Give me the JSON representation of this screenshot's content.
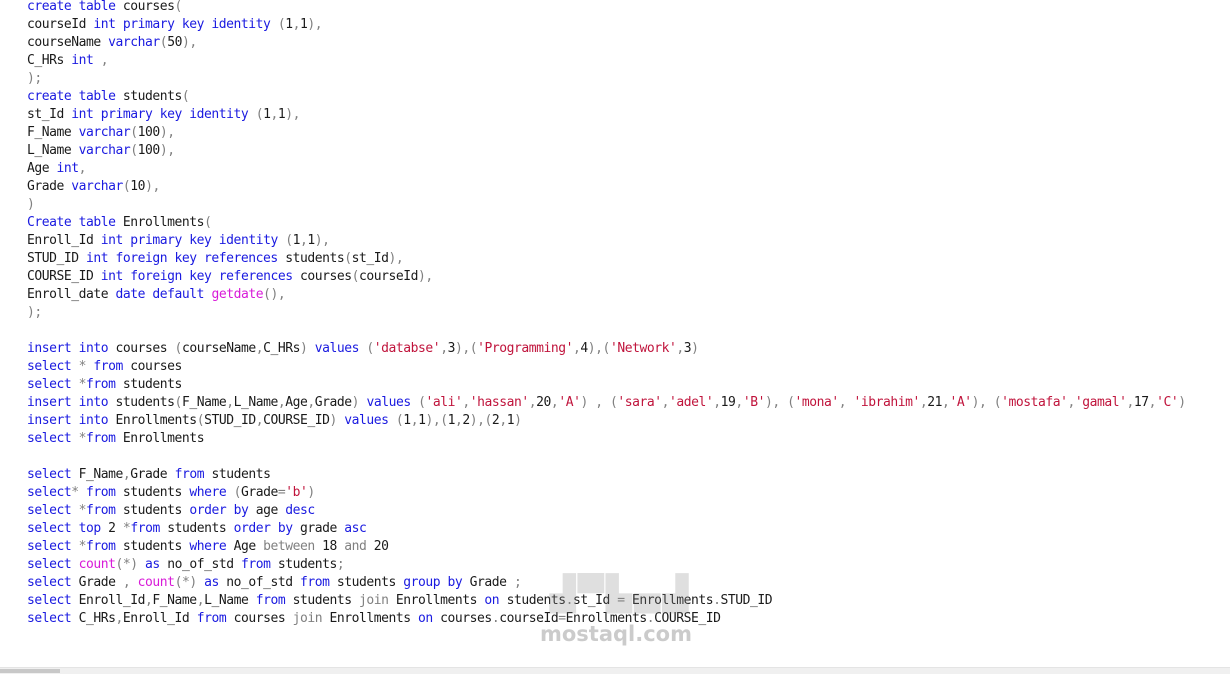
{
  "editor": {
    "lines": [
      [
        [
          "create table ",
          "kw"
        ],
        [
          "courses",
          "pl"
        ],
        [
          "(",
          "gr"
        ]
      ],
      [
        [
          "courseId ",
          "pl"
        ],
        [
          "int primary key identity ",
          "kw"
        ],
        [
          "(",
          "gr"
        ],
        [
          "1",
          "pl"
        ],
        [
          ",",
          "gr"
        ],
        [
          "1",
          "pl"
        ],
        [
          "),",
          "gr"
        ]
      ],
      [
        [
          "courseName ",
          "pl"
        ],
        [
          "varchar",
          "kw"
        ],
        [
          "(",
          "gr"
        ],
        [
          "50",
          "pl"
        ],
        [
          "),",
          "gr"
        ]
      ],
      [
        [
          "C_HRs ",
          "pl"
        ],
        [
          "int ",
          "kw"
        ],
        [
          ",",
          "gr"
        ]
      ],
      [
        [
          ");",
          "gr"
        ]
      ],
      [
        [
          "create table ",
          "kw"
        ],
        [
          "students",
          "pl"
        ],
        [
          "(",
          "gr"
        ]
      ],
      [
        [
          "st_Id ",
          "pl"
        ],
        [
          "int primary key identity ",
          "kw"
        ],
        [
          "(",
          "gr"
        ],
        [
          "1",
          "pl"
        ],
        [
          ",",
          "gr"
        ],
        [
          "1",
          "pl"
        ],
        [
          "),",
          "gr"
        ]
      ],
      [
        [
          "F_Name ",
          "pl"
        ],
        [
          "varchar",
          "kw"
        ],
        [
          "(",
          "gr"
        ],
        [
          "100",
          "pl"
        ],
        [
          "),",
          "gr"
        ]
      ],
      [
        [
          "L_Name ",
          "pl"
        ],
        [
          "varchar",
          "kw"
        ],
        [
          "(",
          "gr"
        ],
        [
          "100",
          "pl"
        ],
        [
          "),",
          "gr"
        ]
      ],
      [
        [
          "Age ",
          "pl"
        ],
        [
          "int",
          "kw"
        ],
        [
          ",",
          "gr"
        ]
      ],
      [
        [
          "Grade ",
          "pl"
        ],
        [
          "varchar",
          "kw"
        ],
        [
          "(",
          "gr"
        ],
        [
          "10",
          "pl"
        ],
        [
          "),",
          "gr"
        ]
      ],
      [
        [
          ")",
          "gr"
        ]
      ],
      [
        [
          "Create table ",
          "kw"
        ],
        [
          "Enrollments",
          "pl"
        ],
        [
          "(",
          "gr"
        ]
      ],
      [
        [
          "Enroll_Id ",
          "pl"
        ],
        [
          "int primary key identity ",
          "kw"
        ],
        [
          "(",
          "gr"
        ],
        [
          "1",
          "pl"
        ],
        [
          ",",
          "gr"
        ],
        [
          "1",
          "pl"
        ],
        [
          "),",
          "gr"
        ]
      ],
      [
        [
          "STUD_ID ",
          "pl"
        ],
        [
          "int foreign key references ",
          "kw"
        ],
        [
          "students",
          "pl"
        ],
        [
          "(",
          "gr"
        ],
        [
          "st_Id",
          "pl"
        ],
        [
          "),",
          "gr"
        ]
      ],
      [
        [
          "COURSE_ID ",
          "pl"
        ],
        [
          "int foreign key references ",
          "kw"
        ],
        [
          "courses",
          "pl"
        ],
        [
          "(",
          "gr"
        ],
        [
          "courseId",
          "pl"
        ],
        [
          "),",
          "gr"
        ]
      ],
      [
        [
          "Enroll_date ",
          "pl"
        ],
        [
          "date default ",
          "kw"
        ],
        [
          "getdate",
          "fn"
        ],
        [
          "(),",
          "gr"
        ]
      ],
      [
        [
          ");",
          "gr"
        ]
      ],
      [
        [
          "",
          "pl"
        ]
      ],
      [
        [
          "insert into ",
          "kw"
        ],
        [
          "courses ",
          "pl"
        ],
        [
          "(",
          "gr"
        ],
        [
          "courseName",
          "pl"
        ],
        [
          ",",
          "gr"
        ],
        [
          "C_HRs",
          "pl"
        ],
        [
          ") ",
          "gr"
        ],
        [
          "values ",
          "kw"
        ],
        [
          "(",
          "gr"
        ],
        [
          "'databse'",
          "str"
        ],
        [
          ",",
          "gr"
        ],
        [
          "3",
          "pl"
        ],
        [
          "),(",
          "gr"
        ],
        [
          "'Programming'",
          "str"
        ],
        [
          ",",
          "gr"
        ],
        [
          "4",
          "pl"
        ],
        [
          "),(",
          "gr"
        ],
        [
          "'Network'",
          "str"
        ],
        [
          ",",
          "gr"
        ],
        [
          "3",
          "pl"
        ],
        [
          ")",
          "gr"
        ]
      ],
      [
        [
          "select ",
          "kw"
        ],
        [
          "* ",
          "gr"
        ],
        [
          "from ",
          "kw"
        ],
        [
          "courses",
          "pl"
        ]
      ],
      [
        [
          "select ",
          "kw"
        ],
        [
          "*",
          "gr"
        ],
        [
          "from ",
          "kw"
        ],
        [
          "students",
          "pl"
        ]
      ],
      [
        [
          "insert into ",
          "kw"
        ],
        [
          "students",
          "pl"
        ],
        [
          "(",
          "gr"
        ],
        [
          "F_Name",
          "pl"
        ],
        [
          ",",
          "gr"
        ],
        [
          "L_Name",
          "pl"
        ],
        [
          ",",
          "gr"
        ],
        [
          "Age",
          "pl"
        ],
        [
          ",",
          "gr"
        ],
        [
          "Grade",
          "pl"
        ],
        [
          ") ",
          "gr"
        ],
        [
          "values ",
          "kw"
        ],
        [
          "(",
          "gr"
        ],
        [
          "'ali'",
          "str"
        ],
        [
          ",",
          "gr"
        ],
        [
          "'hassan'",
          "str"
        ],
        [
          ",",
          "gr"
        ],
        [
          "20",
          "pl"
        ],
        [
          ",",
          "gr"
        ],
        [
          "'A'",
          "str"
        ],
        [
          ") , (",
          "gr"
        ],
        [
          "'sara'",
          "str"
        ],
        [
          ",",
          "gr"
        ],
        [
          "'adel'",
          "str"
        ],
        [
          ",",
          "gr"
        ],
        [
          "19",
          "pl"
        ],
        [
          ",",
          "gr"
        ],
        [
          "'B'",
          "str"
        ],
        [
          "), (",
          "gr"
        ],
        [
          "'mona'",
          "str"
        ],
        [
          ", ",
          "gr"
        ],
        [
          "'ibrahim'",
          "str"
        ],
        [
          ",",
          "gr"
        ],
        [
          "21",
          "pl"
        ],
        [
          ",",
          "gr"
        ],
        [
          "'A'",
          "str"
        ],
        [
          "), (",
          "gr"
        ],
        [
          "'mostafa'",
          "str"
        ],
        [
          ",",
          "gr"
        ],
        [
          "'gamal'",
          "str"
        ],
        [
          ",",
          "gr"
        ],
        [
          "17",
          "pl"
        ],
        [
          ",",
          "gr"
        ],
        [
          "'C'",
          "str"
        ],
        [
          ")",
          "gr"
        ]
      ],
      [
        [
          "insert into ",
          "kw"
        ],
        [
          "Enrollments",
          "pl"
        ],
        [
          "(",
          "gr"
        ],
        [
          "STUD_ID",
          "pl"
        ],
        [
          ",",
          "gr"
        ],
        [
          "COURSE_ID",
          "pl"
        ],
        [
          ") ",
          "gr"
        ],
        [
          "values ",
          "kw"
        ],
        [
          "(",
          "gr"
        ],
        [
          "1",
          "pl"
        ],
        [
          ",",
          "gr"
        ],
        [
          "1",
          "pl"
        ],
        [
          "),(",
          "gr"
        ],
        [
          "1",
          "pl"
        ],
        [
          ",",
          "gr"
        ],
        [
          "2",
          "pl"
        ],
        [
          "),(",
          "gr"
        ],
        [
          "2",
          "pl"
        ],
        [
          ",",
          "gr"
        ],
        [
          "1",
          "pl"
        ],
        [
          ")",
          "gr"
        ]
      ],
      [
        [
          "select ",
          "kw"
        ],
        [
          "*",
          "gr"
        ],
        [
          "from ",
          "kw"
        ],
        [
          "Enrollments",
          "pl"
        ]
      ],
      [
        [
          "",
          "pl"
        ]
      ],
      [
        [
          "select ",
          "kw"
        ],
        [
          "F_Name",
          "pl"
        ],
        [
          ",",
          "gr"
        ],
        [
          "Grade ",
          "pl"
        ],
        [
          "from ",
          "kw"
        ],
        [
          "students",
          "pl"
        ]
      ],
      [
        [
          "select",
          "kw"
        ],
        [
          "* ",
          "gr"
        ],
        [
          "from ",
          "kw"
        ],
        [
          "students ",
          "pl"
        ],
        [
          "where ",
          "kw"
        ],
        [
          "(",
          "gr"
        ],
        [
          "Grade",
          "pl"
        ],
        [
          "=",
          "gr"
        ],
        [
          "'b'",
          "str"
        ],
        [
          ")",
          "gr"
        ]
      ],
      [
        [
          "select ",
          "kw"
        ],
        [
          "*",
          "gr"
        ],
        [
          "from ",
          "kw"
        ],
        [
          "students ",
          "pl"
        ],
        [
          "order by ",
          "kw"
        ],
        [
          "age ",
          "pl"
        ],
        [
          "desc",
          "kw"
        ]
      ],
      [
        [
          "select top ",
          "kw"
        ],
        [
          "2 ",
          "pl"
        ],
        [
          "*",
          "gr"
        ],
        [
          "from ",
          "kw"
        ],
        [
          "students ",
          "pl"
        ],
        [
          "order by ",
          "kw"
        ],
        [
          "grade ",
          "pl"
        ],
        [
          "asc",
          "kw"
        ]
      ],
      [
        [
          "select ",
          "kw"
        ],
        [
          "*",
          "gr"
        ],
        [
          "from ",
          "kw"
        ],
        [
          "students ",
          "pl"
        ],
        [
          "where ",
          "kw"
        ],
        [
          "Age ",
          "pl"
        ],
        [
          "between ",
          "gr"
        ],
        [
          "18 ",
          "pl"
        ],
        [
          "and ",
          "gr"
        ],
        [
          "20",
          "pl"
        ]
      ],
      [
        [
          "select ",
          "kw"
        ],
        [
          "count",
          "fn"
        ],
        [
          "(*) ",
          "gr"
        ],
        [
          "as ",
          "kw"
        ],
        [
          "no_of_std ",
          "pl"
        ],
        [
          "from ",
          "kw"
        ],
        [
          "students",
          "pl"
        ],
        [
          ";",
          "gr"
        ]
      ],
      [
        [
          "select ",
          "kw"
        ],
        [
          "Grade ",
          "pl"
        ],
        [
          ", ",
          "gr"
        ],
        [
          "count",
          "fn"
        ],
        [
          "(*) ",
          "gr"
        ],
        [
          "as ",
          "kw"
        ],
        [
          "no_of_std ",
          "pl"
        ],
        [
          "from ",
          "kw"
        ],
        [
          "students ",
          "pl"
        ],
        [
          "group by ",
          "kw"
        ],
        [
          "Grade ",
          "pl"
        ],
        [
          ";",
          "gr"
        ]
      ],
      [
        [
          "select ",
          "kw"
        ],
        [
          "Enroll_Id",
          "pl"
        ],
        [
          ",",
          "gr"
        ],
        [
          "F_Name",
          "pl"
        ],
        [
          ",",
          "gr"
        ],
        [
          "L_Name ",
          "pl"
        ],
        [
          "from ",
          "kw"
        ],
        [
          "students ",
          "pl"
        ],
        [
          "join ",
          "gr"
        ],
        [
          "Enrollments ",
          "pl"
        ],
        [
          "on ",
          "kw"
        ],
        [
          "students",
          "pl"
        ],
        [
          ".",
          "gr"
        ],
        [
          "st_Id ",
          "pl"
        ],
        [
          "= ",
          "gr"
        ],
        [
          "Enrollments",
          "pl"
        ],
        [
          ".",
          "gr"
        ],
        [
          "STUD_ID",
          "pl"
        ]
      ],
      [
        [
          "select ",
          "kw"
        ],
        [
          "C_HRs",
          "pl"
        ],
        [
          ",",
          "gr"
        ],
        [
          "Enroll_Id ",
          "pl"
        ],
        [
          "from ",
          "kw"
        ],
        [
          "courses ",
          "pl"
        ],
        [
          "join ",
          "gr"
        ],
        [
          "Enrollments ",
          "pl"
        ],
        [
          "on ",
          "kw"
        ],
        [
          "courses",
          "pl"
        ],
        [
          ".",
          "gr"
        ],
        [
          "courseId",
          "pl"
        ],
        [
          "=",
          "gr"
        ],
        [
          "Enrollments",
          "pl"
        ],
        [
          ".",
          "gr"
        ],
        [
          "COURSE_ID",
          "pl"
        ]
      ]
    ]
  },
  "watermark": {
    "text": "mostaql.com"
  },
  "colors": {
    "keyword": "#1a1ae0",
    "string": "#c0143c",
    "function": "#d81bd8",
    "operator": "#808080",
    "text": "#1a1a1a"
  }
}
